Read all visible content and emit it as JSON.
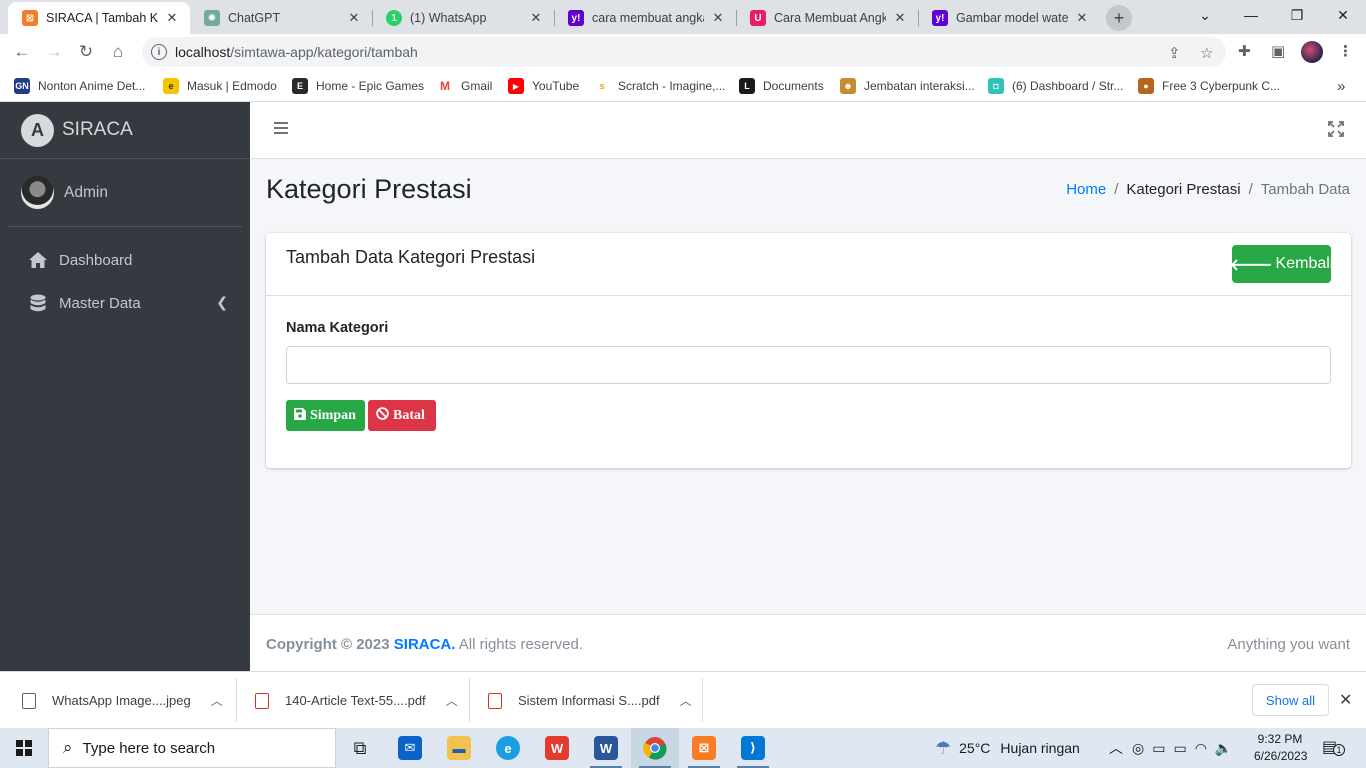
{
  "browser": {
    "tabs": [
      {
        "title": "SIRACA | Tambah Kate",
        "favicon": "xampp-icon",
        "color": "#fb7a24",
        "active": true
      },
      {
        "title": "ChatGPT",
        "favicon": "chatgpt-icon",
        "color": "#74aa9c",
        "active": false
      },
      {
        "title": "(1) WhatsApp",
        "favicon": "whatsapp-icon",
        "color": "#25d366",
        "active": false
      },
      {
        "title": "cara membuat angka",
        "favicon": "yahoo-icon",
        "color": "#6001d2",
        "active": false
      },
      {
        "title": "Cara Membuat Angka",
        "favicon": "magnet-icon",
        "color": "#e91e63",
        "active": false
      },
      {
        "title": "Gambar model water",
        "favicon": "yahoo-icon",
        "color": "#6001d2",
        "active": false
      }
    ],
    "url_host": "localhost",
    "url_path": "/simtawa-app/kategori/tambah",
    "bookmarks": [
      {
        "label": "Nonton Anime Det...",
        "icon": "gn-icon",
        "color": "#1f3c88",
        "glyph": "GN"
      },
      {
        "label": "Masuk | Edmodo",
        "icon": "edmodo-icon",
        "color": "#f5c400",
        "glyph": "e"
      },
      {
        "label": "Home - Epic Games",
        "icon": "epic-games-icon",
        "color": "#2a2a2a",
        "glyph": "E"
      },
      {
        "label": "Gmail",
        "icon": "gmail-icon",
        "color": "#ea4335",
        "glyph": "M"
      },
      {
        "label": "YouTube",
        "icon": "youtube-icon",
        "color": "#ff0000",
        "glyph": "▶"
      },
      {
        "label": "Scratch - Imagine,...",
        "icon": "scratch-icon",
        "color": "#f9a825",
        "glyph": "S"
      },
      {
        "label": "Documents",
        "icon": "documents-icon",
        "color": "#1a1a1a",
        "glyph": "L"
      },
      {
        "label": "Jembatan interaksi...",
        "icon": "bear-icon",
        "color": "#c98b2f",
        "glyph": "☻"
      },
      {
        "label": "(6) Dashboard / Str...",
        "icon": "dashboard-icon",
        "color": "#2ec4b6",
        "glyph": "◘"
      },
      {
        "label": "Free 3 Cyberpunk C...",
        "icon": "cyberpunk-icon",
        "color": "#b5651d",
        "glyph": "●"
      }
    ]
  },
  "app": {
    "brand": "SIRACA",
    "brand_logo_letter": "A",
    "user_name": "Admin",
    "nav": [
      {
        "label": "Dashboard",
        "icon": "home-icon"
      },
      {
        "label": "Master Data",
        "icon": "database-icon"
      }
    ],
    "page_title": "Kategori Prestasi",
    "breadcrumb": {
      "home": "Home",
      "section": "Kategori Prestasi",
      "current": "Tambah Data"
    },
    "card": {
      "title": "Tambah Data Kategori Prestasi",
      "back_label": "Kembali",
      "field_label": "Nama Kategori",
      "field_value": "",
      "save_label": "Simpan",
      "cancel_label": "Batal"
    },
    "footer": {
      "copyright_prefix": "Copyright © 2023",
      "brand": "SIRACA.",
      "rights": "All rights reserved.",
      "right_text": "Anything you want"
    }
  },
  "downloads": [
    {
      "name": "WhatsApp Image....jpeg",
      "type": "image"
    },
    {
      "name": "140-Article Text-55....pdf",
      "type": "pdf"
    },
    {
      "name": "Sistem Informasi S....pdf",
      "type": "pdf"
    }
  ],
  "downloads_show_all": "Show all",
  "taskbar": {
    "search_placeholder": "Type here to search",
    "weather_temp": "25°C",
    "weather_desc": "Hujan ringan",
    "time": "9:32 PM",
    "date": "6/26/2023",
    "notification_count": "1"
  }
}
